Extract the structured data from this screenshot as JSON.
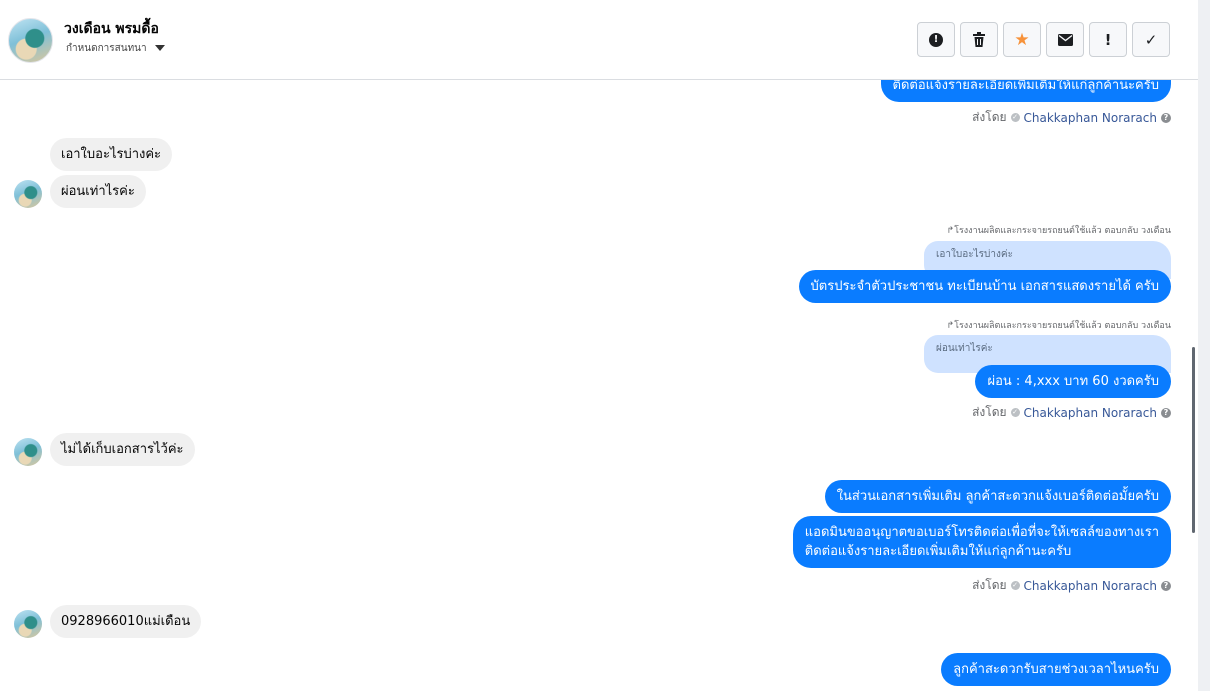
{
  "header": {
    "contact_name": "วงเดือน พรมดื้อ",
    "subtitle": "กำหนดการสนทนา",
    "toolbar": [
      {
        "icon": "report-icon",
        "glyph": "!"
      },
      {
        "icon": "trash-icon",
        "glyph": "🗑"
      },
      {
        "icon": "star-icon",
        "glyph": "★"
      },
      {
        "icon": "mail-icon",
        "glyph": "✉"
      },
      {
        "icon": "exclamation-icon",
        "glyph": "!"
      },
      {
        "icon": "check-icon",
        "glyph": "✓"
      }
    ]
  },
  "messages": {
    "m0": "ติดต่อแจ้งรายละเอียดเพิ่มเติมให้แก่ลูกค้านะครับ",
    "sent_by_label": "ส่งโดย",
    "sender": "Chakkaphan Norarach",
    "in1": "เอาใบอะไรบ่างค่ะ",
    "in2": "ผ่อนเท่าไรค่ะ",
    "reply1_note": "โรงงานผลิตและกระจายรถยนต์ใช้แล้ว ตอบกลับ วงเดือน",
    "reply1_quote": "เอาใบอะไรบ่างค่ะ",
    "out1": "บัตรประจำตัวประชาชน ทะเบียนบ้าน เอกสารแสดงรายได้ ครับ",
    "reply2_note": "โรงงานผลิตและกระจายรถยนต์ใช้แล้ว ตอบกลับ วงเดือน",
    "reply2_quote": "ผ่อนเท่าไรค่ะ",
    "out2": "ผ่อน : 4,xxx บาท 60 งวดครับ",
    "in3": "ไม่ได้เก็บเอกสารไว้ค่ะ",
    "out3": "ในส่วนเอกสารเพิ่มเติม ลูกค้าสะดวกแจ้งเบอร์ติดต่อมั้ยครับ",
    "out4_line1": "แอดมินขออนุญาตขอเบอร์โทรติดต่อเพื่อที่จะให้เซลล์ของทางเรา",
    "out4_line2": "ติดต่อแจ้งรายละเอียดเพิ่มเติมให้แก่ลูกค้านะครับ",
    "in4": "0928966010แม่เดือน",
    "out5": "ลูกค้าสะดวกรับสายช่วงเวลาไหนครับ"
  },
  "colors": {
    "accent": "#0a7cff",
    "incoming": "#f0f0f0",
    "quote": "#cfe2ff",
    "star": "#f7923a"
  }
}
